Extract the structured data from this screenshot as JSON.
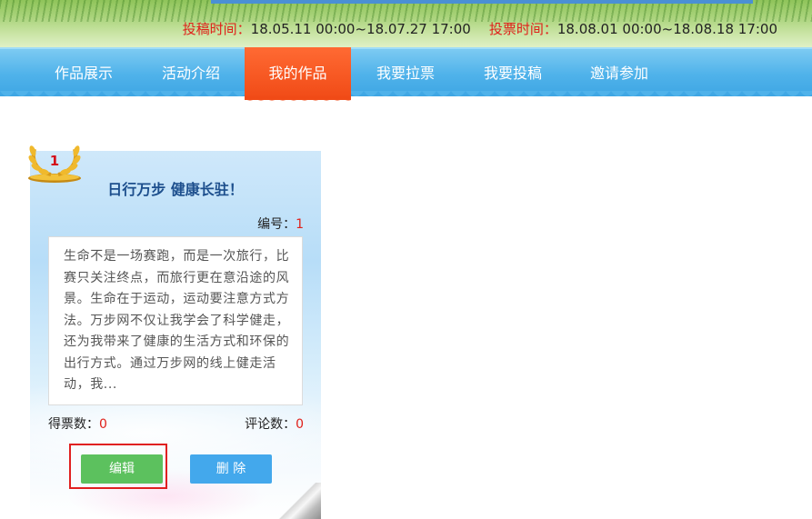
{
  "header": {
    "submit_label": "投稿时间：",
    "submit_range": "18.05.11 00:00~18.07.27 17:00",
    "vote_label": "投票时间：",
    "vote_range": "18.08.01 00:00~18.08.18 17:00"
  },
  "nav": {
    "items": [
      {
        "label": "作品展示"
      },
      {
        "label": "活动介绍"
      },
      {
        "label": "我的作品"
      },
      {
        "label": "我要拉票"
      },
      {
        "label": "我要投稿"
      },
      {
        "label": "邀请参加"
      }
    ],
    "active_index": 2
  },
  "entry": {
    "rank": "1",
    "title": "日行万步 健康长驻！",
    "id_label": "编号：",
    "id_value": "1",
    "description": "生命不是一场赛跑，而是一次旅行，比赛只关注终点，而旅行更在意沿途的风景。生命在于运动，运动要注意方式方法。万步网不仅让我学会了科学健走，还为我带来了健康的生活方式和环保的出行方式。通过万步网的线上健走活动，我...",
    "votes_label": "得票数：",
    "votes_value": "0",
    "comments_label": "评论数：",
    "comments_value": "0",
    "edit_label": "编辑",
    "delete_label": "删 除"
  },
  "colors": {
    "nav_bg": "#4fb2ea",
    "nav_active": "#f04a16",
    "label_red": "#e0201a",
    "title_blue": "#1d4f8d",
    "edit_green": "#5cc15e",
    "delete_blue": "#43a8ec",
    "highlight_red": "#e02020"
  },
  "icons": {
    "badge": "laurel-medal-icon"
  }
}
